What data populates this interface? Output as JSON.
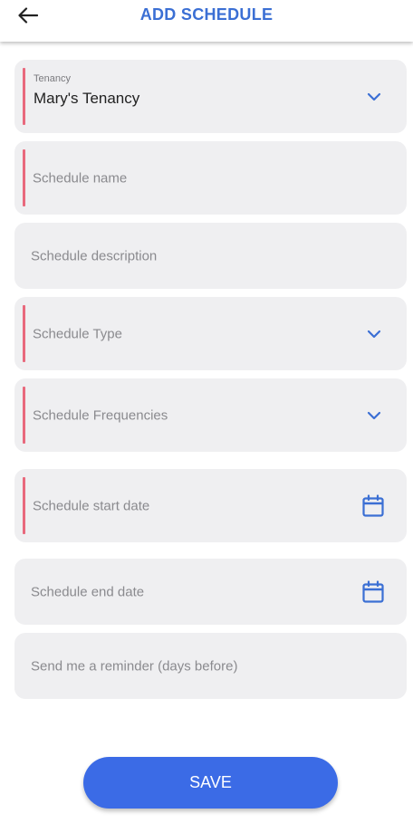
{
  "header": {
    "title": "ADD SCHEDULE",
    "back_icon": "arrow-left-icon"
  },
  "form": {
    "tenancy": {
      "label": "Tenancy",
      "value": "Mary's Tenancy"
    },
    "schedule_name": {
      "placeholder": "Schedule name"
    },
    "schedule_description": {
      "placeholder": "Schedule description"
    },
    "schedule_type": {
      "placeholder": "Schedule Type"
    },
    "schedule_frequencies": {
      "placeholder": "Schedule Frequencies"
    },
    "schedule_start_date": {
      "placeholder": "Schedule start date"
    },
    "schedule_end_date": {
      "placeholder": "Schedule end date"
    },
    "reminder": {
      "placeholder": "Send me a reminder (days before)"
    }
  },
  "save_label": "SAVE",
  "colors": {
    "accent": "#3b6fd4",
    "required": "#e8697d",
    "button": "#3b6be6",
    "field_bg": "#efeff1"
  }
}
